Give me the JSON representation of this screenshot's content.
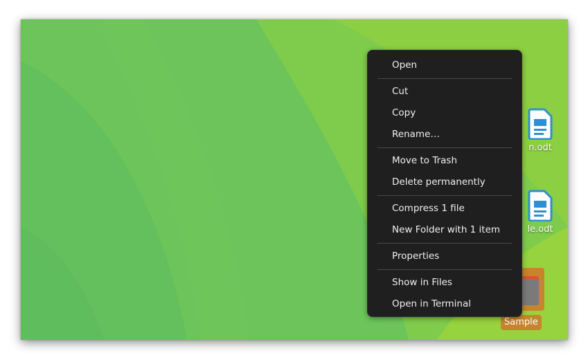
{
  "desktop": {
    "wallpaper_colors": [
      "#6cc45a",
      "#7ccb4f",
      "#8ed040",
      "#62bf5c"
    ],
    "icons": [
      {
        "label": "Lorem.odt",
        "visible_label": "n.odt",
        "type": "document-icon",
        "color": "#2d8fd0"
      },
      {
        "label": "Sample.odt",
        "visible_label": "le.odt",
        "type": "document-icon",
        "color": "#2d8fd0"
      },
      {
        "label": "Sample",
        "visible_label": "Sample",
        "type": "folder-icon",
        "selected": true,
        "selection_color": "#c8842c"
      }
    ]
  },
  "context_menu": {
    "groups": [
      [
        "Open"
      ],
      [
        "Cut",
        "Copy",
        "Rename…"
      ],
      [
        "Move to Trash",
        "Delete permanently"
      ],
      [
        "Compress 1 file",
        "New Folder with 1 item"
      ],
      [
        "Properties"
      ],
      [
        "Show in Files",
        "Open in Terminal"
      ]
    ],
    "items": {
      "open": "Open",
      "cut": "Cut",
      "copy": "Copy",
      "rename": "Rename…",
      "move_to_trash": "Move to Trash",
      "delete_permanently": "Delete permanently",
      "compress": "Compress 1 file",
      "new_folder": "New Folder with 1 item",
      "properties": "Properties",
      "show_in_files": "Show in Files",
      "open_in_terminal": "Open in Terminal"
    }
  }
}
